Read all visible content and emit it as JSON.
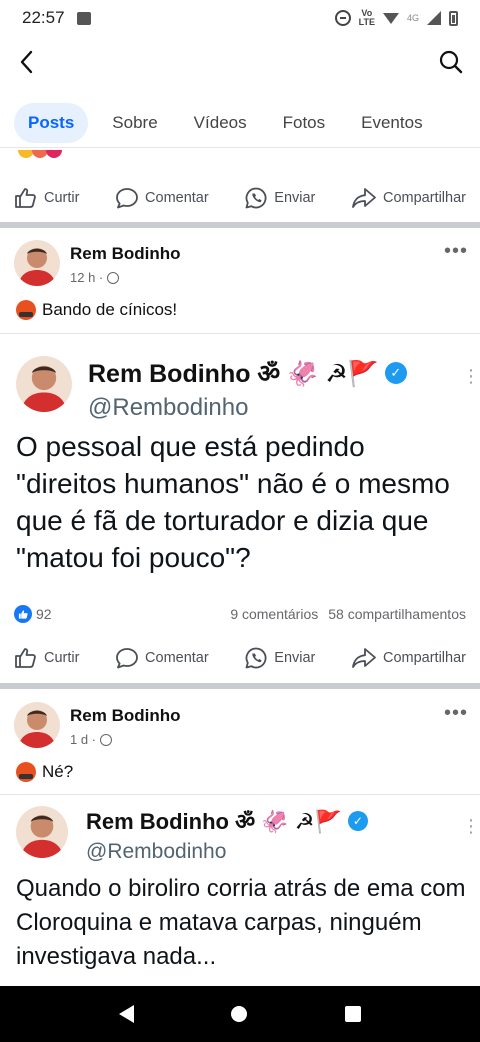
{
  "status_bar": {
    "time": "22:57",
    "network_top": "Vo",
    "network_bottom": "LTE",
    "net_4g": "4G"
  },
  "tabs": [
    {
      "label": "Posts",
      "active": true
    },
    {
      "label": "Sobre"
    },
    {
      "label": "Vídeos"
    },
    {
      "label": "Fotos"
    },
    {
      "label": "Eventos"
    }
  ],
  "actions": {
    "like": "Curtir",
    "comment": "Comentar",
    "send": "Enviar",
    "share": "Compartilhar"
  },
  "posts": [
    {
      "author": "Rem Bodinho",
      "time": "12 h ·",
      "caption": "Bando de cínicos!",
      "tweet": {
        "name": "Rem Bodinho ॐ 🦑 ☭🚩",
        "handle": "@Rembodinho",
        "text": "O pessoal que está pedindo \"direitos humanos\" não é o mesmo que é fã de torturador e dizia que \"matou foi pouco\"?"
      },
      "reactions": {
        "count": "92",
        "comments": "9 comentários",
        "shares": "58 compartilhamentos"
      }
    },
    {
      "author": "Rem Bodinho",
      "time": "1 d ·",
      "caption": "Né?",
      "tweet": {
        "name": "Rem Bodinho ॐ 🦑 ☭🚩",
        "handle": "@Rembodinho",
        "text": "Quando o biroliro corria atrás de ema com Cloroquina e matava carpas, ninguém investigava nada..."
      }
    }
  ],
  "colors": {
    "accent": "#0866ff",
    "like": "#1877f2",
    "verified": "#1d9bf0"
  }
}
